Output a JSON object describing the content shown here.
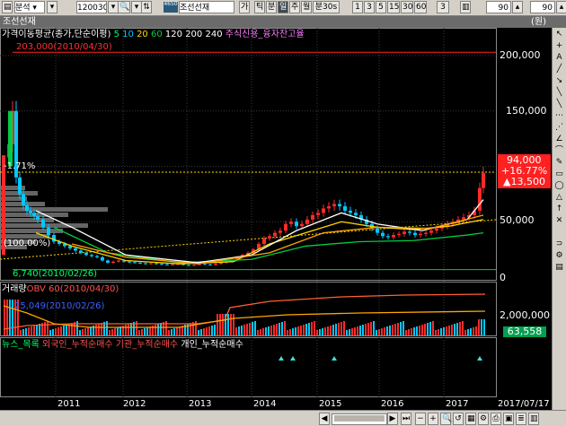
{
  "toolbar": {
    "code": "120030",
    "name": "조선선재",
    "menu_label": "분석",
    "buttons": [
      "가",
      "틱",
      "분",
      "일",
      "주",
      "월",
      "분30s",
      "1",
      "3",
      "5",
      "15",
      "30",
      "60",
      "3"
    ],
    "tag": "4650",
    "zoom1": "90",
    "zoom2": "90"
  },
  "header": {
    "title": "조선선재",
    "right": "(원)"
  },
  "price_panel": {
    "ma_label": "가격이동평균(종가,단순이평)",
    "ma_periods": [
      "5",
      "10",
      "20",
      "60",
      "120",
      "200",
      "240"
    ],
    "credit_label": "주식신용_융자잔고율",
    "max_label": "203,000(2010/04/30)",
    "min_label": "6,740(2010/02/26)",
    "pct_top": "-1.71%",
    "pct_bottom": "(100.00%)",
    "y_ticks": [
      "200,000",
      "150,000",
      "100,000",
      "50,000",
      "0"
    ],
    "current": {
      "price": "94,000",
      "pct": "+16.77%",
      "chg": "▲13,500"
    }
  },
  "volume_panel": {
    "title": "거래량",
    "label1": "OBV 60(2010/04/30)",
    "label2": "25,049(2010/02/26)",
    "y_tick": "2,000,000",
    "current": "63,558"
  },
  "news_panel": {
    "labels": [
      "뉴스_목록",
      "외국인_누적순매수",
      "기관_누적순매수",
      "개인_누적순매수"
    ]
  },
  "x_axis": [
    "2011",
    "2012",
    "2013",
    "2014",
    "2015",
    "2016",
    "2017",
    "2017/07/17"
  ],
  "colors": {
    "up": "#ff2a2a",
    "down": "#00c8ff",
    "ma5": "#ffffff",
    "ma20": "#ffd700",
    "ma60": "#00cc44",
    "red_text": "#ff3030",
    "green_text": "#00ff66"
  },
  "chart_data": {
    "type": "candlestick",
    "title": "조선선재",
    "y_ticks": [
      0,
      50000,
      100000,
      150000,
      200000
    ],
    "x_labels": [
      "2011",
      "2012",
      "2013",
      "2014",
      "2015",
      "2016",
      "2017"
    ],
    "annotations": {
      "max": {
        "value": 203000,
        "date": "2010/04/30"
      },
      "min": {
        "value": 6740,
        "date": "2010/02/26"
      },
      "last": {
        "value": 94000,
        "change": 13500,
        "change_pct": 16.77
      }
    },
    "volume_last": 63558
  }
}
